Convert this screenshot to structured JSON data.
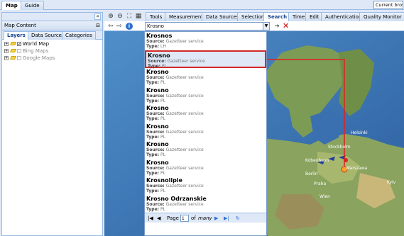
{
  "top_tabs": [
    {
      "label": "Map"
    },
    {
      "label": "Guide"
    }
  ],
  "browser_button": "Current brows",
  "left_panel": {
    "title": "Map Content",
    "tabs": [
      {
        "label": "Layers"
      },
      {
        "label": "Data Sources"
      },
      {
        "label": "Categories"
      }
    ],
    "layers": [
      {
        "label": "World Map",
        "checked": true
      },
      {
        "label": "Bing Maps",
        "checked": false
      },
      {
        "label": "Google Maps",
        "checked": false
      }
    ]
  },
  "main_tabs": [
    {
      "label": "Tools"
    },
    {
      "label": "Measurements"
    },
    {
      "label": "Data Sources"
    },
    {
      "label": "Selection"
    },
    {
      "label": "Search"
    },
    {
      "label": "Time"
    },
    {
      "label": "Edit"
    },
    {
      "label": "Authentication"
    },
    {
      "label": "Quality Monitor"
    }
  ],
  "search": {
    "value": "Krosno"
  },
  "results": [
    {
      "name": "Krosnos",
      "source": "Gazetteer service",
      "type": "LH"
    },
    {
      "name": "Krosno",
      "source": "Gazetteer service",
      "type": "PL"
    },
    {
      "name": "Krosno",
      "source": "Gazetteer service",
      "type": "PL"
    },
    {
      "name": "Krosno",
      "source": "Gazetteer service",
      "type": "PL"
    },
    {
      "name": "Krosno",
      "source": "Gazetteer service",
      "type": "PL"
    },
    {
      "name": "Krosno",
      "source": "Gazetteer service",
      "type": "PL"
    },
    {
      "name": "Krosno",
      "source": "Gazetteer service",
      "type": "PL"
    },
    {
      "name": "Krosno",
      "source": "Gazetteer service",
      "type": "PL"
    },
    {
      "name": "Krosnolipie",
      "source": "Gazetteer service",
      "type": "PL"
    },
    {
      "name": "Krosno Odrzanskie",
      "source": "Gazetteer service",
      "type": "PL"
    }
  ],
  "labels": {
    "source": "Source:",
    "type": "Type:"
  },
  "pager": {
    "page_label": "Page",
    "page": "1",
    "of_label": "of",
    "total": "many"
  },
  "map_labels": {
    "helsinki": "Helsinki",
    "stockholm": "Stockholm",
    "kobenhavn": "Kobenhavn",
    "berlin": "Berlin",
    "praha": "Praha",
    "wien": "Wien",
    "warszawa": "Warszawa",
    "kyiv": "Kyiv"
  },
  "colors": {
    "selection": "#d12a2a",
    "route": "#e02020",
    "water": "#2c5d9e"
  }
}
